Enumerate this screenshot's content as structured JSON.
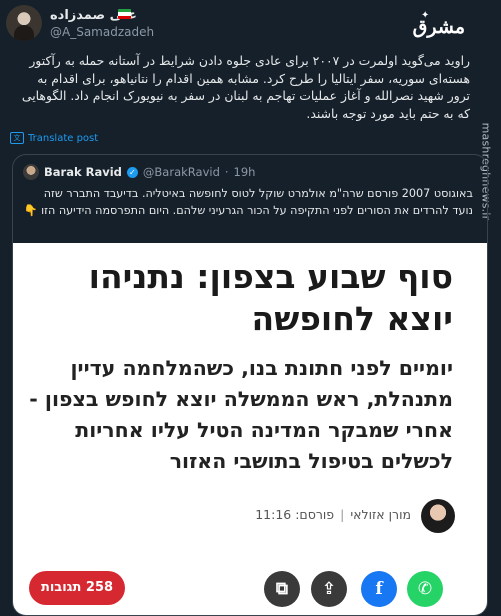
{
  "author": {
    "name": "علی صمدزاده",
    "handle": "@A_Samadzadeh",
    "flag_colors": [
      "#239f40",
      "#ffffff",
      "#da0000"
    ]
  },
  "logo": {
    "text": "مشرق"
  },
  "watermark": {
    "text": "mashreghnews.ir"
  },
  "tweet": {
    "text": "راوید می‌گوید اولمرت در ۲۰۰۷ برای عادی جلوه دادن شرایط در آستانه حمله به رآکتور هسته‌ای سوریه، سفر ایتالیا را طرح کرد. مشابه همین اقدام را نتانیاهو، برای اقدام به ترور شهید نصرالله و آغاز عملیات تهاجم به لبنان در سفر به نیویورک انجام داد. الگوهایی که به حتم باید مورد توجه باشند."
  },
  "translate": {
    "label": "Translate post"
  },
  "quote": {
    "name": "Barak Ravid",
    "handle": "@BarakRavid",
    "time": "19h",
    "text": "באוגוסט 2007 פורסם שרה\"מ אולמרט שוקל לטוס לחופשה באיטליה. בדיעבד התברר שזה נועד להרדים את הסורים לפני התקיפה על הכור הגרעיני שלהם. היום התפרסמה הידיעה הזו 👇"
  },
  "article": {
    "headline": "סוף שבוע בצפון: נתניהו יוצא לחופשה",
    "subtitle": "יומיים לפני חתונת בנו, כשהמלחמה עדיין מתנהלת, ראש הממשלה יוצא לחופש בצפון - אחרי שמבקר המדינה הטיל עליו אחריות לכשלים בטיפול בתושבי האזור",
    "author": "מורן אזולאי",
    "published": "פורסם: 11:16"
  },
  "actions": {
    "comments": "258 תגובות",
    "colors": {
      "comments": "#d62830",
      "facebook": "#1877f2",
      "whatsapp": "#25d366"
    }
  }
}
